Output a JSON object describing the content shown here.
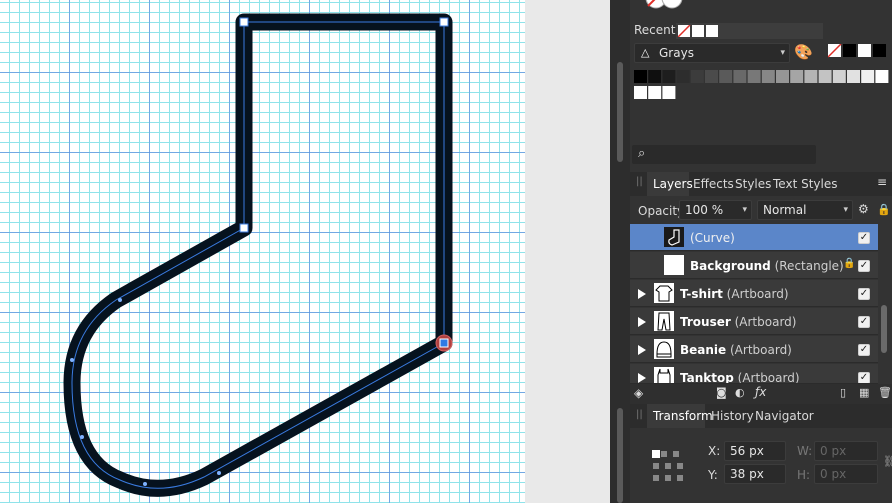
{
  "swatches": {
    "recent_label": "Recent:",
    "palette_name": "Grays"
  },
  "search": {
    "placeholder": ""
  },
  "layers_panel": {
    "tabs": [
      "Layers",
      "Effects",
      "Styles",
      "Text Styles"
    ],
    "opacity_label": "Opacity:",
    "opacity_value": "100 %",
    "blend_mode": "Normal",
    "layers": [
      {
        "name": "",
        "type": "(Curve)",
        "selected": true
      },
      {
        "name": "Background",
        "type": " (Rectangle)",
        "locked": true
      },
      {
        "name": "T-shirt",
        "type": " (Artboard)"
      },
      {
        "name": "Trouser",
        "type": " (Artboard)"
      },
      {
        "name": "Beanie",
        "type": " (Artboard)"
      },
      {
        "name": "Tanktop",
        "type": " (Artboard)"
      }
    ]
  },
  "transform_panel": {
    "tabs": [
      "Transform",
      "History",
      "Navigator"
    ],
    "x_label": "X:",
    "x_value": "56 px",
    "y_label": "Y:",
    "y_value": "38 px",
    "w_label": "W:",
    "w_value": "0 px",
    "h_label": "H:",
    "h_value": "0 px"
  },
  "colors": {
    "accent": "#5b86c9",
    "shape_stroke": "#06121e",
    "grid_minor": "#8fe3ea",
    "grid_major": "#5a78dc"
  }
}
